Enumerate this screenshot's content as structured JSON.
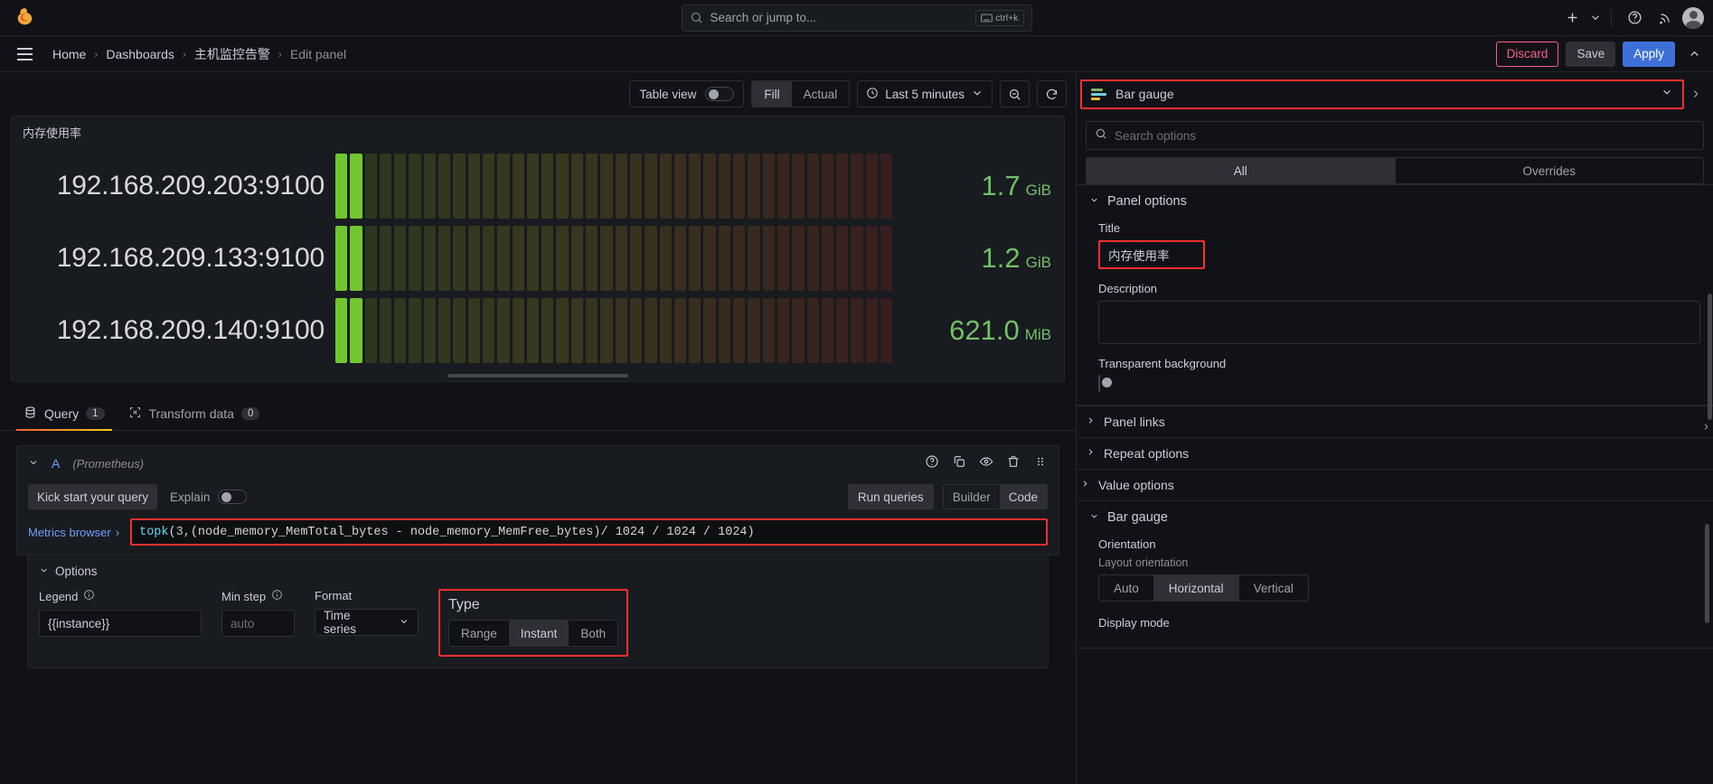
{
  "topbar": {
    "logo_icon": "grafana-logo-icon",
    "search": {
      "placeholder": "Search or jump to...",
      "icon": "search-icon",
      "shortcut": "ctrl+k",
      "kbd_icon": "keyboard-icon"
    },
    "add_label": "+",
    "icons": [
      "plus-icon",
      "chevron-down-icon",
      "help-circle-icon",
      "news-rss-icon",
      "user-avatar"
    ]
  },
  "breadcrumb": {
    "menu_icon": "hamburger-menu-icon",
    "items": [
      {
        "label": "Home",
        "current": false
      },
      {
        "label": "Dashboards",
        "current": false
      },
      {
        "label": "主机监控告警",
        "current": false
      },
      {
        "label": "Edit panel",
        "current": true
      }
    ],
    "separator": "›",
    "actions": {
      "discard": "Discard",
      "save": "Save",
      "apply": "Apply",
      "collapse_icon": "chevron-up-icon"
    }
  },
  "toolbar": {
    "table_view_label": "Table view",
    "table_view_on": false,
    "fit_options": [
      "Fill",
      "Actual"
    ],
    "fit_selected": "Fill",
    "time_range": "Last 5 minutes",
    "time_icon": "clock-icon",
    "time_chevron": "chevron-down-icon",
    "zoom_out_icon": "zoom-out-icon",
    "refresh_icon": "refresh-icon"
  },
  "viz_picker": {
    "name": "Bar gauge",
    "icon": "bar-gauge-icon",
    "chevron": "chevron-down-icon",
    "highlight_color": "#ff2f2f"
  },
  "panel": {
    "title": "内存使用率",
    "scrollbar": true
  },
  "chart_data": {
    "type": "bar",
    "title": "内存使用率",
    "categories": [
      "192.168.209.203:9100",
      "192.168.209.133:9100",
      "192.168.209.140:9100"
    ],
    "values": [
      1.7,
      1.2,
      0.606
    ],
    "display_values": [
      "1.7",
      "1.2",
      "621.0"
    ],
    "units": [
      "GiB",
      "GiB",
      "MiB"
    ],
    "value_color": "#73bf69",
    "orientation": "horizontal",
    "display_mode": "retro-lcd",
    "cell_count": 38,
    "fill_cells": [
      2,
      2,
      2
    ],
    "ylabel": "",
    "xlabel": "",
    "legend": false
  },
  "query_tabs": [
    {
      "label": "Query",
      "count": "1",
      "icon": "database-icon",
      "active": true
    },
    {
      "label": "Transform data",
      "count": "0",
      "icon": "transform-icon",
      "active": false
    }
  ],
  "query": {
    "ref_id": "A",
    "datasource": "(Prometheus)",
    "chevron": "chevron-down-icon",
    "header_icons": [
      "help-circle-icon",
      "copy-icon",
      "eye-icon",
      "trash-icon",
      "drag-handle-icon"
    ],
    "kick_start": "Kick start your query",
    "explain_label": "Explain",
    "explain_on": false,
    "run_queries": "Run queries",
    "mode_options": [
      "Builder",
      "Code"
    ],
    "mode_selected": "Code",
    "metrics_browser": "Metrics browser",
    "metrics_browser_chevron": "›",
    "expression": "topk(3,(node_memory_MemTotal_bytes - node_memory_MemFree_bytes) / 1024 / 1024 / 1024)",
    "expression_tokens": {
      "fn": "topk",
      "open": "(",
      "arg": "3,",
      "inner": "(node_memory_MemTotal_bytes - node_memory_MemFree_bytes)",
      "tail": " / 1024 / 1024 / 1024)"
    },
    "options": {
      "header": "Options",
      "chevron": "chevron-down-icon",
      "legend_label": "Legend",
      "legend_info_icon": "info-circle-icon",
      "legend_value": "{{instance}}",
      "min_step_label": "Min step",
      "min_step_info_icon": "info-circle-icon",
      "min_step_placeholder": "auto",
      "format_label": "Format",
      "format_value": "Time series",
      "format_chevron": "chevron-down-icon",
      "type_label": "Type",
      "type_options": [
        "Range",
        "Instant",
        "Both"
      ],
      "type_selected": "Instant"
    }
  },
  "options_pane": {
    "search_placeholder": "Search options",
    "search_icon": "search-icon",
    "tabs": [
      {
        "label": "All",
        "active": true
      },
      {
        "label": "Overrides",
        "active": false
      }
    ],
    "panel_options": {
      "header": "Panel options",
      "title_label": "Title",
      "title_value": "内存使用率",
      "description_label": "Description",
      "description_value": "",
      "transparent_label": "Transparent background",
      "transparent_on": false,
      "panel_links": "Panel links",
      "repeat_options": "Repeat options"
    },
    "value_options": {
      "header": "Value options"
    },
    "bar_gauge": {
      "header": "Bar gauge",
      "orientation_label": "Orientation",
      "orientation_sub": "Layout orientation",
      "orientation_options": [
        "Auto",
        "Horizontal",
        "Vertical"
      ],
      "orientation_selected": "Horizontal",
      "display_mode_label": "Display mode"
    }
  }
}
